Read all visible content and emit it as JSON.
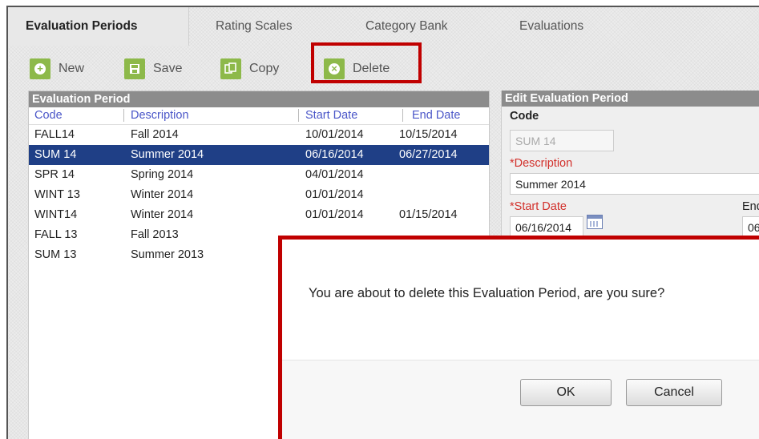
{
  "tabs": [
    {
      "label": "Evaluation Periods",
      "active": true
    },
    {
      "label": "Rating Scales"
    },
    {
      "label": "Category Bank"
    },
    {
      "label": "Evaluations"
    }
  ],
  "toolbar": {
    "new_label": "New",
    "save_label": "Save",
    "copy_label": "Copy",
    "delete_label": "Delete"
  },
  "list": {
    "title": "Evaluation Period",
    "columns": [
      "Code",
      "Description",
      "Start Date",
      "End Date"
    ],
    "rows": [
      {
        "code": "FALL14",
        "description": "Fall 2014",
        "start": "10/01/2014",
        "end": "10/15/2014"
      },
      {
        "code": "SUM 14",
        "description": "Summer 2014",
        "start": "06/16/2014",
        "end": "06/27/2014",
        "selected": true
      },
      {
        "code": "SPR 14",
        "description": "Spring 2014",
        "start": "04/01/2014",
        "end": ""
      },
      {
        "code": "WINT 13",
        "description": "Winter 2014",
        "start": "01/01/2014",
        "end": ""
      },
      {
        "code": "WINT14",
        "description": "Winter 2014",
        "start": "01/01/2014",
        "end": "01/15/2014"
      },
      {
        "code": "FALL 13",
        "description": "Fall 2013",
        "start": "",
        "end": ""
      },
      {
        "code": "SUM 13",
        "description": "Summer 2013",
        "start": "",
        "end": ""
      }
    ]
  },
  "edit": {
    "title": "Edit Evaluation Period",
    "code_label": "Code",
    "code_value": "SUM 14",
    "description_label": "*Description",
    "description_value": "Summer 2014",
    "start_label": "*Start Date",
    "start_value": "06/16/2014",
    "end_label_partial": "End",
    "end_value_partial": "06"
  },
  "dialog": {
    "message": "You are about to delete this Evaluation Period, are you sure?",
    "ok_label": "OK",
    "cancel_label": "Cancel"
  },
  "colors": {
    "accent_green": "#8db94a",
    "highlight_red": "#c00000",
    "selected_row": "#1f3f86",
    "column_header": "#4a56c8",
    "required_label": "#d2302b"
  }
}
